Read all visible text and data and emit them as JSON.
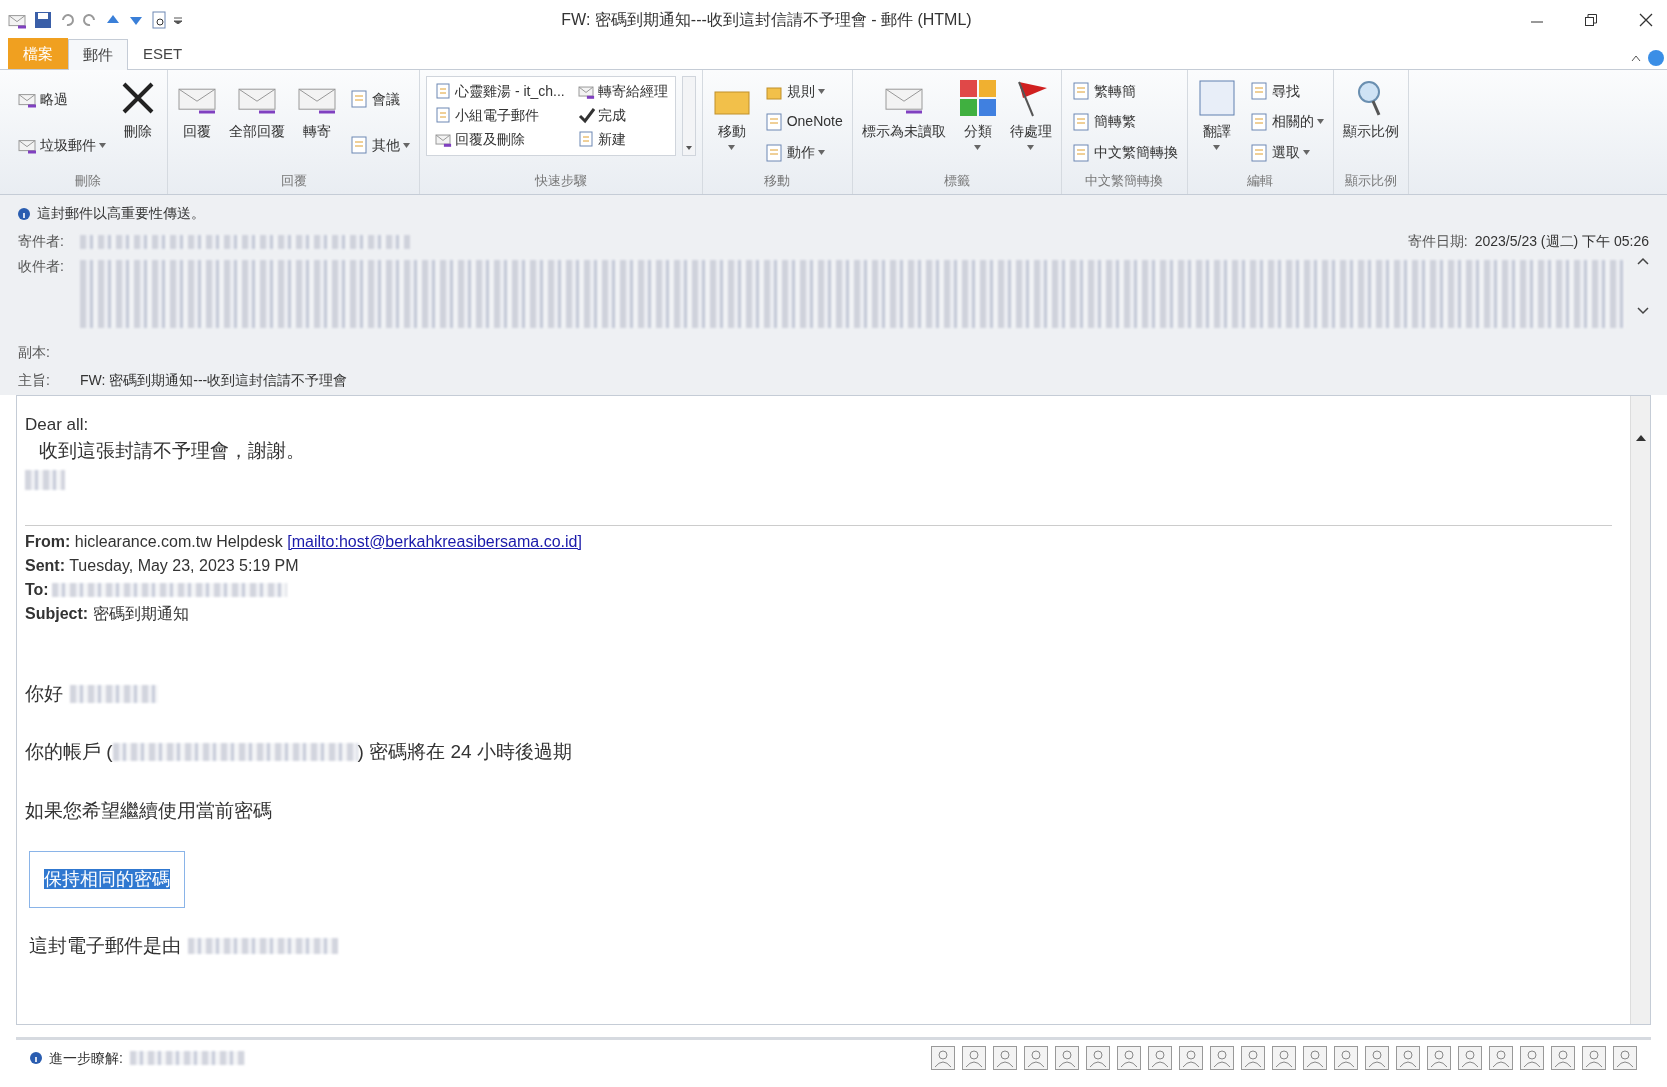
{
  "window": {
    "title": "FW: 密碼到期通知---收到這封信請不予理會 - 郵件 (HTML)"
  },
  "tabs": [
    {
      "label": "檔案",
      "kind": "file",
      "selected": false
    },
    {
      "label": "郵件",
      "kind": "tab",
      "selected": true
    },
    {
      "label": "ESET",
      "kind": "tab",
      "selected": false
    }
  ],
  "ribbon_groups": [
    {
      "label": "刪除",
      "items": [
        {
          "label": "略過",
          "kind": "small",
          "dropdown": false
        },
        {
          "label": "垃圾郵件",
          "kind": "small",
          "dropdown": true
        },
        {
          "label": "刪除",
          "kind": "large",
          "dropdown": false
        }
      ]
    },
    {
      "label": "回覆",
      "items": [
        {
          "label": "回覆",
          "kind": "large",
          "dropdown": false
        },
        {
          "label": "全部回覆",
          "kind": "large",
          "dropdown": false
        },
        {
          "label": "轉寄",
          "kind": "large",
          "dropdown": false
        },
        {
          "label": "會議",
          "kind": "small",
          "dropdown": false
        },
        {
          "label": "其他",
          "kind": "small",
          "dropdown": true
        }
      ]
    },
    {
      "label": "快速步驟",
      "items": [
        {
          "label": "心靈雞湯 - it_ch...",
          "kind": "gallery"
        },
        {
          "label": "小組電子郵件",
          "kind": "gallery"
        },
        {
          "label": "回覆及刪除",
          "kind": "gallery"
        },
        {
          "label": "轉寄給經理",
          "kind": "gallery"
        },
        {
          "label": "完成",
          "kind": "gallery"
        },
        {
          "label": "新建",
          "kind": "gallery"
        }
      ]
    },
    {
      "label": "移動",
      "items": [
        {
          "label": "移動",
          "kind": "large",
          "dropdown": true
        },
        {
          "label": "規則",
          "kind": "small",
          "dropdown": true
        },
        {
          "label": "OneNote",
          "kind": "small",
          "dropdown": false
        },
        {
          "label": "動作",
          "kind": "small",
          "dropdown": true
        }
      ]
    },
    {
      "label": "標籤",
      "items": [
        {
          "label": "標示為未讀取",
          "kind": "large",
          "dropdown": false
        },
        {
          "label": "分類",
          "kind": "large",
          "dropdown": true
        },
        {
          "label": "待處理",
          "kind": "large",
          "dropdown": true
        }
      ]
    },
    {
      "label": "中文繁簡轉換",
      "items": [
        {
          "label": "繁轉簡",
          "kind": "small",
          "dropdown": false
        },
        {
          "label": "簡轉繁",
          "kind": "small",
          "dropdown": false
        },
        {
          "label": "中文繁簡轉換",
          "kind": "small",
          "dropdown": false
        }
      ]
    },
    {
      "label": "編輯",
      "items": [
        {
          "label": "翻譯",
          "kind": "large",
          "dropdown": true
        },
        {
          "label": "尋找",
          "kind": "small",
          "dropdown": false
        },
        {
          "label": "相關的",
          "kind": "small",
          "dropdown": true
        },
        {
          "label": "選取",
          "kind": "small",
          "dropdown": true
        }
      ]
    },
    {
      "label": "顯示比例",
      "items": [
        {
          "label": "顯示比例",
          "kind": "large",
          "dropdown": false
        }
      ]
    }
  ],
  "info_bar": "這封郵件以高重要性傳送。",
  "header": {
    "from_label": "寄件者:",
    "date_label": "寄件日期:",
    "date": "2023/5/23 (週二) 下午 05:26",
    "to_label": "收件者:",
    "cc_label": "副本:",
    "subject_label": "主旨:",
    "subject": "FW: 密碼到期通知---收到這封信請不予理會"
  },
  "body": {
    "greeting": "Dear all:",
    "note": "收到這張封請不予理會，謝謝。",
    "from_line": "**From:** hiclearance.com.tw Helpdesk",
    "from_link": "[mailto:host@berkahkreasibersama.co.id]",
    "sent_line": "**Sent:** Tuesday, May 23, 2023 5:19 PM",
    "to_label": "To:",
    "subject_line": "**Subject:** 密碼到期通知",
    "hello": "你好",
    "account_prefix": "你的帳戶 (",
    "account_suffix": ") 密碼將在 24 小時後過期",
    "continue": "如果您希望繼續使用當前密碼",
    "keep_button": {
      "label": "保持相同的密碼",
      "selected": true
    },
    "footer": "這封電子郵件是由"
  },
  "status_bar": {
    "label": "進一步瞭解:"
  }
}
